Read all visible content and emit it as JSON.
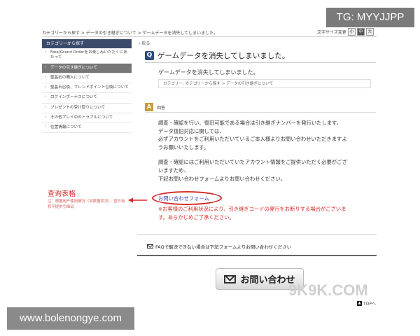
{
  "watermarks": {
    "tg": "TG: MYYJJPP",
    "site": "www.bolenongye.com",
    "brand": "9K9K.COM"
  },
  "breadcrumb": "カテゴリーから探す > データの引き継ぎについて > ゲームデータを消失してしまいました。",
  "font_size": {
    "label": "文字サイズ変更",
    "options": [
      "小",
      "中",
      "大"
    ],
    "selected": "中"
  },
  "sidebar": {
    "header": "カテゴリーから探す",
    "items": [
      {
        "label": "Fate/Grand Orderをお楽しみいただくにあたって",
        "active": false
      },
      {
        "label": "データの引き継ぎについて",
        "active": true
      },
      {
        "label": "聖晶石の購入について",
        "active": false
      },
      {
        "label": "聖晶石召喚、フレンドポイント召喚について",
        "active": false
      },
      {
        "label": "ログインボーナスについて",
        "active": false
      },
      {
        "label": "プレゼントの受け取りについて",
        "active": false
      },
      {
        "label": "その他プレイ中のトラブルについて",
        "active": false
      },
      {
        "label": "位置情報について",
        "active": false
      }
    ]
  },
  "back_label": "戻る",
  "question": {
    "badge": "Q",
    "title": "ゲームデータを消失してしまいました。",
    "subtitle": "ゲームデータを消失してしまいました。",
    "category": "カテゴリー: カテゴリーから探す > データの引き継ぎについて"
  },
  "answer": {
    "badge": "A",
    "label": "回答",
    "para1": [
      "調査・確認を行い、復旧可能である場合は引き継ぎナンバーを発行いたします。",
      "データ復旧対応に関しては、",
      "必ずアカウントをご利用いただいているご本人様よりお問い合わせいただきますよ",
      "うお願いいたします。"
    ],
    "para2": [
      "調査・確認にはご利用いただいていたアカウント情報をご提供いただく必要がござ",
      "いますため、",
      "下記お問い合わせフォームよりお問い合わせください。"
    ],
    "form_link": "お問い合わせフォーム",
    "red_note": [
      "※お客様のご利用状況により、引き継ぎコードの発行をお断りする場合がございま",
      "す。あらかじめご了承ください。"
    ]
  },
  "annotation": {
    "title": "查询表格",
    "sub": "注：根据用户使用情况（如数据状况），官方有权不提供引继码"
  },
  "faq": {
    "text": "FAQで解決できない場合は下記フォームよりお問い合わせください"
  },
  "contact_button": "お問い合わせ",
  "top_link": "TOPへ",
  "colors": {
    "accent_red": "#d42a2a",
    "sidebar_header": "#3b4a6b",
    "q_badge": "#2a4c7c",
    "a_badge": "#c89b3a"
  }
}
